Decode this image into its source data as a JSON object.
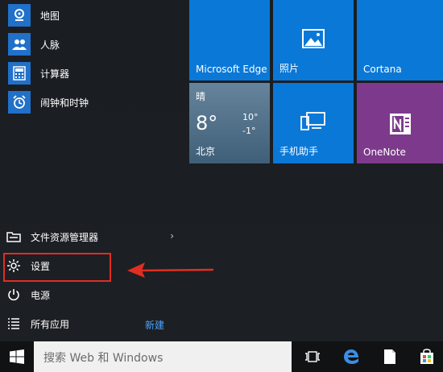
{
  "apps": [
    {
      "label": "地图",
      "icon": "maps-icon"
    },
    {
      "label": "人脉",
      "icon": "people-icon"
    },
    {
      "label": "计算器",
      "icon": "calculator-icon"
    },
    {
      "label": "闹钟和时钟",
      "icon": "alarm-icon"
    }
  ],
  "tiles": {
    "edge": "Microsoft Edge",
    "photos": "照片",
    "cortana": "Cortana",
    "phone": "手机助手",
    "onenote": "OneNote"
  },
  "weather": {
    "condition": "晴",
    "temp": "8°",
    "high": "10°",
    "low": "-1°",
    "city": "北京"
  },
  "bottom": {
    "explorer": "文件资源管理器",
    "settings": "设置",
    "power": "电源",
    "all_apps": "所有应用",
    "new": "新建"
  },
  "taskbar": {
    "search_placeholder": "搜索 Web 和 Windows"
  },
  "colors": {
    "tile_blue": "#0a78d7",
    "onenote_purple": "#7d3a8c",
    "highlight_red": "#e22d22",
    "link_blue": "#4aa3ff"
  }
}
